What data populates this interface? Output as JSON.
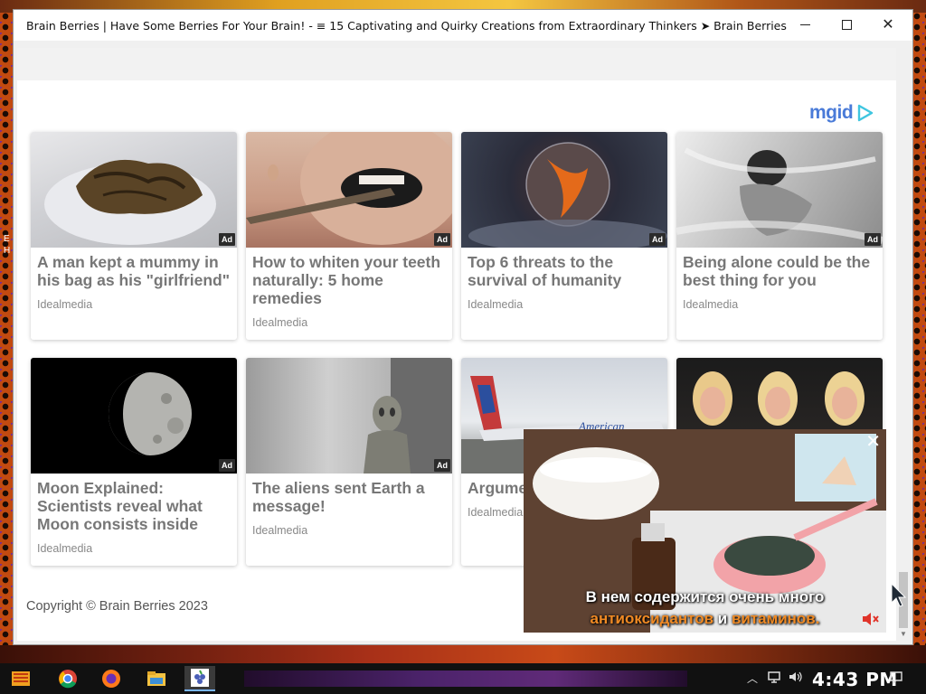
{
  "window": {
    "title": "Brain Berries | Have Some Berries For Your Brain! - ≡ 15 Captivating and Quirky Creations from Extraordinary Thinkers ➤ Brain Berries",
    "close_glyph": "✕"
  },
  "desktop": {
    "edge_text": "E\nH"
  },
  "ad_network": {
    "logo_text": "mgid",
    "brand_color": "#4a7bd8"
  },
  "cards": [
    {
      "title": "A man kept a mummy in his bag as his \"girlfriend\"",
      "source": "Idealmedia",
      "badge": "Ad"
    },
    {
      "title": "How to whiten your teeth naturally: 5 home remedies",
      "source": "Idealmedia",
      "badge": "Ad"
    },
    {
      "title": "Top 6 threats to the survival of humanity",
      "source": "Idealmedia",
      "badge": "Ad"
    },
    {
      "title": "Being alone could be the best thing for you",
      "source": "Idealmedia",
      "badge": "Ad"
    },
    {
      "title": "Moon Explained: Scientists reveal what Moon consists inside",
      "source": "Idealmedia",
      "badge": "Ad"
    },
    {
      "title": "The aliens sent Earth a message!",
      "source": "Idealmedia",
      "badge": "Ad"
    },
    {
      "title": "Argume resulted each ot",
      "source": "Idealmedia",
      "badge": ""
    },
    {
      "title": "",
      "source": "",
      "badge": ""
    }
  ],
  "footer": {
    "copyright": "Copyright © Brain Berries 2023"
  },
  "video": {
    "close_glyph": "✕",
    "subtitle_line1": "В нем содержится очень много",
    "subtitle_line2_a": "антиоксидантов",
    "subtitle_line2_b": " и ",
    "subtitle_line2_c": "витаминов.",
    "plane_text": "American",
    "highlight_color": "#f08a24"
  },
  "taskbar": {
    "clock": "4:43 PM",
    "apps": [
      "start-icon",
      "chrome-icon",
      "firefox-icon",
      "file-explorer-icon",
      "berries-app-icon"
    ]
  }
}
